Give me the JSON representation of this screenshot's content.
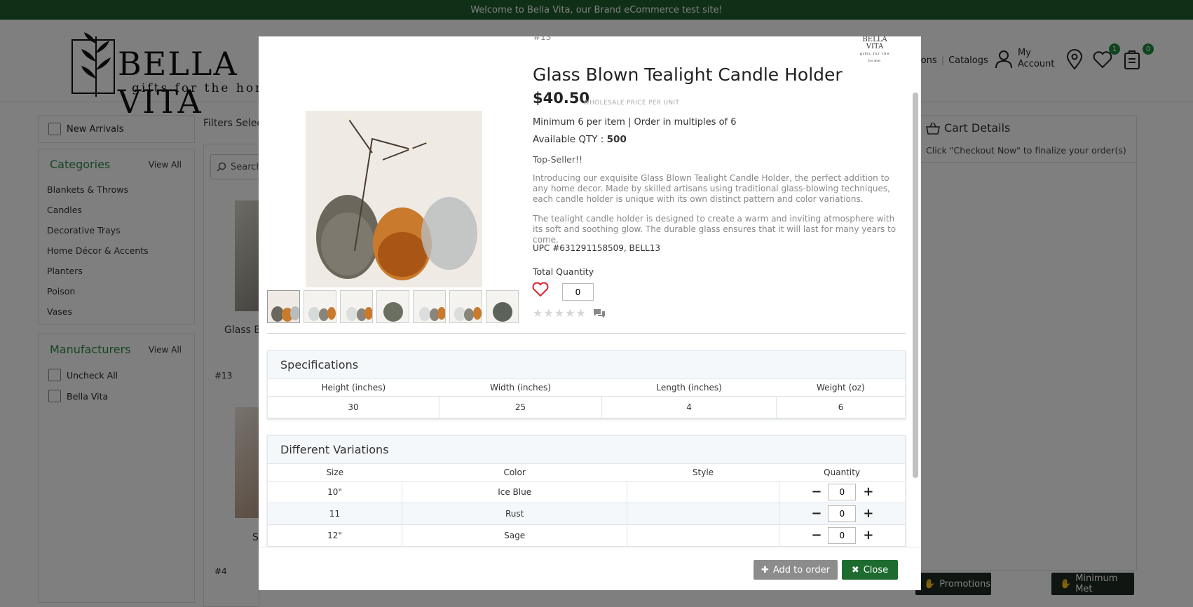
{
  "announcement": "Welcome to Bella Vita, our Brand eCommerce test site!",
  "brand": {
    "name": "BELLA VITA",
    "tagline": "gifts for the home",
    "mini_name": "BELLA VITA",
    "mini_tagline": "gifts for the home"
  },
  "header": {
    "nav_partial": "tions",
    "catalogs": "Catalogs",
    "account_line1": "My",
    "account_line2": "Account",
    "wishlist_count": "1",
    "cart_count": "0"
  },
  "sidebar": {
    "new_arrivals": "New Arrivals",
    "categories_title": "Categories",
    "view_all": "View All",
    "categories": [
      "Blankets & Throws",
      "Candles",
      "Decorative Trays",
      "Home Décor & Accents",
      "Planters",
      "Poison",
      "Vases"
    ],
    "manufacturers_title": "Manufacturers",
    "manufacturers": [
      "Uncheck All",
      "Bella Vita"
    ]
  },
  "main": {
    "filters_label": "Filters Select",
    "search_placeholder": "Search",
    "card_title_partial": "Glass B",
    "num_13": "#13",
    "card_letter": "S",
    "num_4": "#4"
  },
  "cart": {
    "title": "Cart Details",
    "subtitle": "Click \"Checkout Now\" to finalize your order(s)",
    "promotions": "Promotions",
    "minimum_met": "Minimum Met"
  },
  "modal": {
    "product_num": "#13",
    "title": "Glass Blown Tealight Candle Holder",
    "price": "$40.50",
    "price_note": "WHOLESALE PRICE PER UNIT",
    "min_text": "Minimum 6 per item | Order in multiples of 6",
    "available_label": "Available QTY : ",
    "available_value": "500",
    "top_seller": "Top-Seller!!",
    "desc1": "Introducing our exquisite Glass Blown Tealight Candle Holder, the perfect addition to any home decor. Made by skilled artisans using traditional glass-blowing techniques, each candle holder is unique with its own distinct pattern and color variations.",
    "desc2": "The tealight candle holder is designed to create a warm and inviting atmosphere with its soft and soothing glow. The durable glass ensures that it will last for many years to come.",
    "upc": "UPC #631291158509, BELL13",
    "total_qty_label": "Total Quantity",
    "total_qty_value": "0",
    "specs": {
      "title": "Specifications",
      "headers": [
        "Height (inches)",
        "Width (inches)",
        "Length (inches)",
        "Weight (oz)"
      ],
      "values": [
        "30",
        "25",
        "4",
        "6"
      ]
    },
    "variations": {
      "title": "Different Variations",
      "headers": [
        "Size",
        "Color",
        "Style",
        "Quantity"
      ],
      "rows": [
        {
          "size": "10\"",
          "color": "Ice Blue",
          "style": "",
          "qty": "0"
        },
        {
          "size": "11",
          "color": "Rust",
          "style": "",
          "qty": "0"
        },
        {
          "size": "12\"",
          "color": "Sage",
          "style": "",
          "qty": "0"
        }
      ]
    },
    "add_to_order": "Add to order",
    "close": "Close"
  },
  "colors": {
    "brand_green": "#1f5e2c",
    "accent_green": "#2e8a47",
    "close_green": "#1d6b2e"
  }
}
